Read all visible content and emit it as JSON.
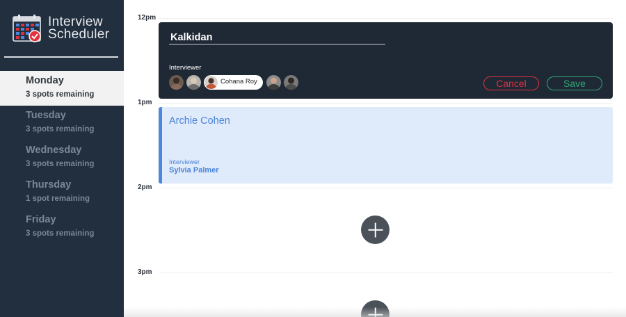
{
  "brand": {
    "title_line1": "Interview",
    "title_line2": "Scheduler",
    "icon": "calendar-check-icon"
  },
  "sidebar": {
    "days": [
      {
        "name": "Monday",
        "spots": "3 spots remaining",
        "selected": true
      },
      {
        "name": "Tuesday",
        "spots": "3 spots remaining",
        "selected": false
      },
      {
        "name": "Wednesday",
        "spots": "3 spots remaining",
        "selected": false
      },
      {
        "name": "Thursday",
        "spots": "1 spot remaining",
        "selected": false
      },
      {
        "name": "Friday",
        "spots": "3 spots remaining",
        "selected": false
      }
    ]
  },
  "schedule": {
    "times": [
      "12pm",
      "1pm",
      "2pm",
      "3pm"
    ],
    "form": {
      "student_name_value": "Kalkidan",
      "interviewer_label": "Interviewer",
      "selected_interviewer": "Cohana Roy",
      "cancel_label": "Cancel",
      "save_label": "Save"
    },
    "appointment": {
      "student": "Archie Cohen",
      "interviewer_label": "Interviewer",
      "interviewer": "Sylvia Palmer"
    }
  },
  "colors": {
    "sidebar_bg": "#222f3e",
    "form_bg": "#1f2935",
    "cancel": "#e0303c",
    "save": "#2fa877",
    "appointment_accent": "#4d87e0",
    "appointment_bg": "#dfeafa"
  }
}
